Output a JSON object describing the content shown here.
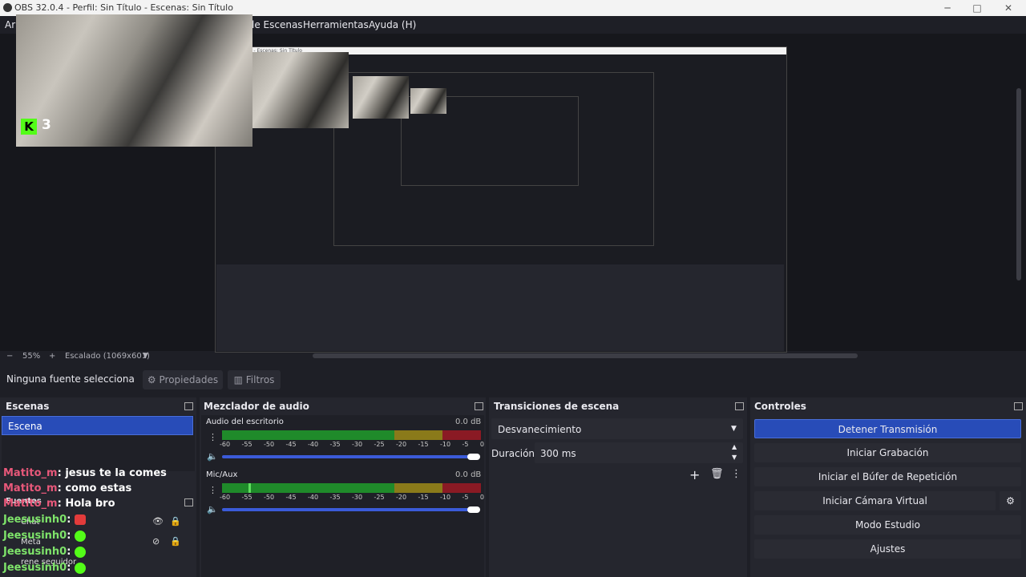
{
  "window": {
    "title": "OBS 32.0.4 - Perfil: Sin Título - Escenas: Sin Título",
    "minimize": "─",
    "maximize": "□",
    "close": "✕"
  },
  "menu": {
    "partial": "Ar",
    "items": [
      "le Escenas",
      "Herramientas",
      "Ayuda (H)"
    ]
  },
  "preview": {
    "badge_letter": "K",
    "badge_number": "3",
    "zoom": "55%",
    "zoom_minus": "−",
    "zoom_plus": "+",
    "scaling": "Escalado (1069x601)",
    "nested_title": "OBS Sin Título - Escenas: Sin Título",
    "nested_menu": "le Escenas  Herramientas  Ayuda (H)"
  },
  "source_toolbar": {
    "no_source": "Ninguna fuente selecciona",
    "properties": "Propiedades",
    "filters": "Filtros"
  },
  "scenes": {
    "title": "Escenas",
    "items": [
      "Escena"
    ]
  },
  "sources": {
    "title": "Fuentes",
    "items": [
      "Chat",
      "Meta",
      "rene seguidor"
    ]
  },
  "chat_overlay": [
    {
      "user": "Matito_m",
      "msg": "jesus te la comes",
      "color": "#e8587a"
    },
    {
      "user": "Matito_m",
      "msg": "como estas",
      "color": "#e8587a"
    },
    {
      "user": "Matito_m",
      "msg": "Hola bro",
      "color": "#e8587a"
    },
    {
      "user": "Jeesusinh0",
      "msg": "",
      "color": "#7ee36a"
    },
    {
      "user": "Jeesusinh0",
      "msg": "",
      "color": "#7ee36a"
    },
    {
      "user": "Jeesusinh0",
      "msg": "",
      "color": "#7ee36a"
    },
    {
      "user": "Jeesusinh0",
      "msg": "",
      "color": "#7ee36a"
    }
  ],
  "mixer": {
    "title": "Mezclador de audio",
    "channels": [
      {
        "name": "Audio del escritorio",
        "db": "0.0 dB"
      },
      {
        "name": "Mic/Aux",
        "db": "0.0 dB"
      }
    ],
    "scale": [
      "-60",
      "-55",
      "-50",
      "-45",
      "-40",
      "-35",
      "-30",
      "-25",
      "-20",
      "-15",
      "-10",
      "-5",
      "0"
    ]
  },
  "transitions": {
    "title": "Transiciones de escena",
    "selected": "Desvanecimiento",
    "duration_label": "Duración",
    "duration_value": "300 ms"
  },
  "controls": {
    "title": "Controles",
    "buttons": [
      "Detener Transmisión",
      "Iniciar Grabación",
      "Iniciar el Búfer de Repetición",
      "Iniciar Cámara Virtual",
      "Modo Estudio",
      "Ajustes"
    ]
  },
  "colors": {
    "accent": "#284cb8",
    "meter_green": "#1f8a2a",
    "meter_yellow": "#8a7a1a",
    "meter_red": "#8a1a24",
    "kick_green": "#53fc18"
  }
}
